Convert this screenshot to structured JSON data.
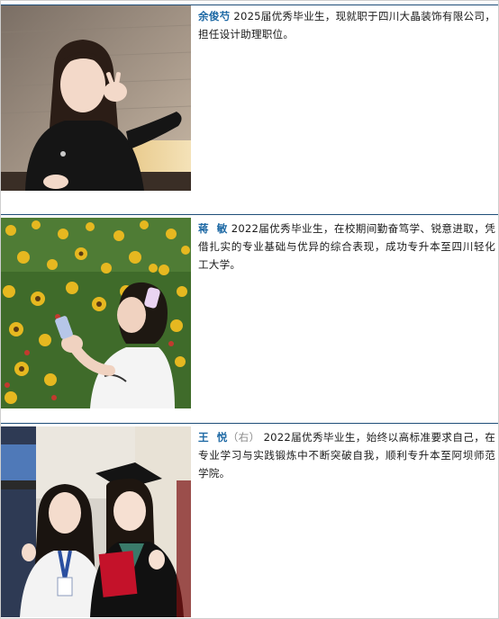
{
  "entries": [
    {
      "name": "余俊芍",
      "note": "",
      "description": "2025届优秀毕业生，现就职于四川大晶装饰有限公司，担任设计助理职位。",
      "photo": "portrait-photo"
    },
    {
      "name": "蒋  敏",
      "note": "",
      "description": "2022届优秀毕业生，在校期间勤奋笃学、锐意进取，凭借扎实的专业基础与优异的综合表现，成功专升本至四川轻化工大学。",
      "photo": "sunflower-field-photo"
    },
    {
      "name": "王  悦",
      "note": "（右）",
      "description": "2022届优秀毕业生，始终以高标准要求自己，在专业学习与实践锻炼中不断突破自我，顺利专升本至阿坝师范学院。",
      "photo": "graduation-photo"
    }
  ]
}
